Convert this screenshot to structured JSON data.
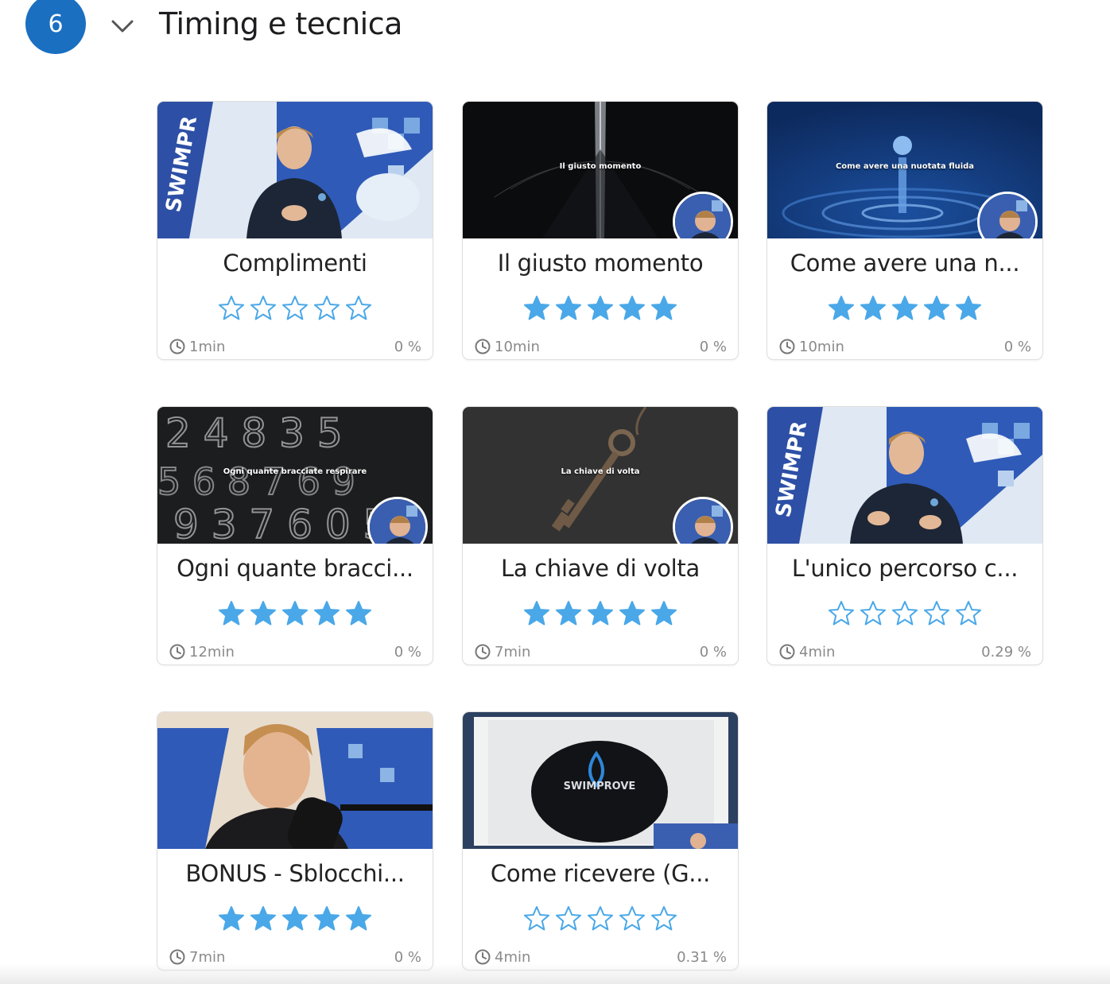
{
  "section": {
    "number": "6",
    "title": "Timing e tecnica"
  },
  "theme": {
    "accent": "#1a6fc1",
    "star_color": "#4aa8e8",
    "muted_text": "#8a8a8a"
  },
  "lessons": [
    {
      "title": "Complimenti",
      "duration": "1min",
      "progress": "0 %",
      "rating_filled": false,
      "caption": "",
      "thumbnail": "presenter-swimprove-banner",
      "avatar": false
    },
    {
      "title": "Il giusto momento",
      "duration": "10min",
      "progress": "0 %",
      "rating_filled": true,
      "caption": "Il giusto momento",
      "thumbnail": "metronome-dark",
      "avatar": true
    },
    {
      "title": "Come avere una n...",
      "duration": "10min",
      "progress": "0 %",
      "rating_filled": true,
      "caption": "Come avere una nuotata fluida",
      "thumbnail": "water-drop-blue",
      "avatar": true
    },
    {
      "title": "Ogni quante bracci...",
      "duration": "12min",
      "progress": "0 %",
      "rating_filled": true,
      "caption": "Ogni quante bracciate respirare",
      "thumbnail": "chalk-numbers",
      "avatar": true
    },
    {
      "title": "La chiave di volta",
      "duration": "7min",
      "progress": "0 %",
      "rating_filled": true,
      "caption": "La chiave di volta",
      "thumbnail": "old-key",
      "avatar": true
    },
    {
      "title": "L'unico percorso c...",
      "duration": "4min",
      "progress": "0.29 %",
      "rating_filled": false,
      "caption": "",
      "thumbnail": "presenter-swimprove-banner",
      "avatar": false
    },
    {
      "title": "BONUS - Sblocchi...",
      "duration": "7min",
      "progress": "0 %",
      "rating_filled": true,
      "caption": "",
      "thumbnail": "presenter-microphone",
      "avatar": false
    },
    {
      "title": "Come ricevere (G...",
      "duration": "4min",
      "progress": "0.31 %",
      "rating_filled": false,
      "caption": "",
      "thumbnail": "swim-cap-product",
      "avatar": false
    }
  ],
  "thumbnail_texts": {
    "cap_brand": "SWIMPROVE"
  }
}
